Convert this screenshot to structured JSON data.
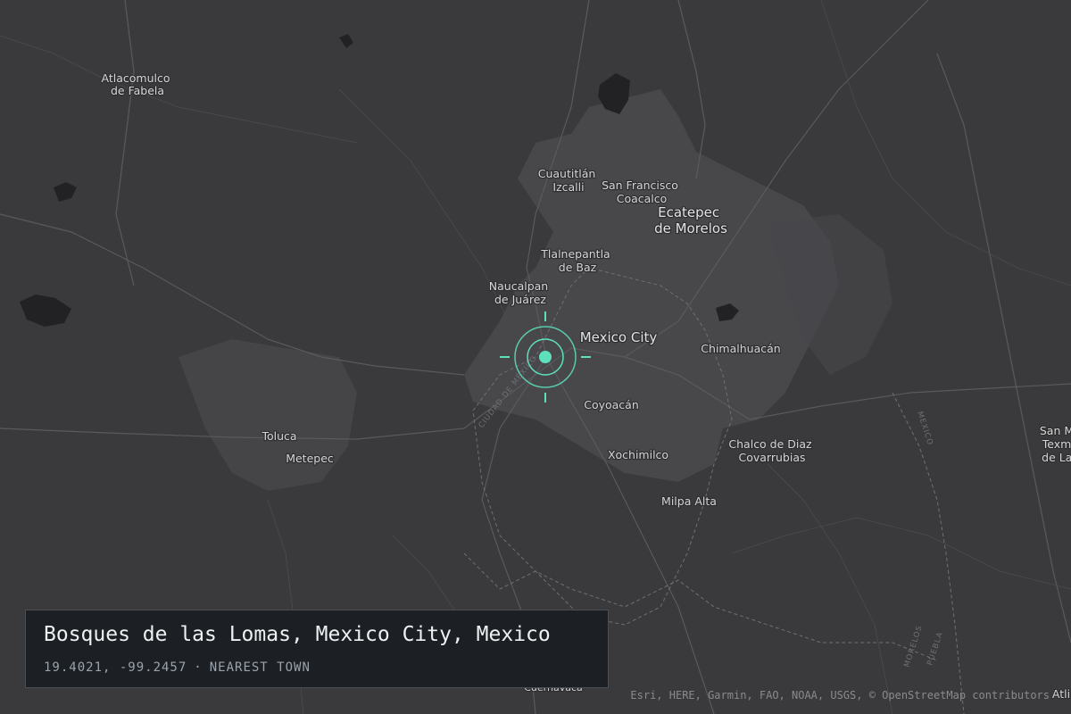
{
  "map": {
    "places": [
      {
        "id": "atlacomulco",
        "lines": [
          "Atlacomulco",
          "de Fabela"
        ]
      },
      {
        "id": "cuautitlan",
        "lines": [
          "Cuautitlán",
          "Izcalli"
        ]
      },
      {
        "id": "san-francisco",
        "lines": [
          "San Francisco",
          "Coacalco"
        ]
      },
      {
        "id": "ecatepec",
        "lines": [
          "Ecatepec",
          "de Morelos"
        ]
      },
      {
        "id": "tlalnepantla",
        "lines": [
          "Tlalnepantla",
          "de Baz"
        ]
      },
      {
        "id": "naucalpan",
        "lines": [
          "Naucalpan",
          "de Juárez"
        ]
      },
      {
        "id": "mexico-city",
        "lines": [
          "Mexico City"
        ]
      },
      {
        "id": "chimalhuacan",
        "lines": [
          "Chimalhuacán"
        ]
      },
      {
        "id": "coyoacan",
        "lines": [
          "Coyoacán"
        ]
      },
      {
        "id": "toluca",
        "lines": [
          "Toluca"
        ]
      },
      {
        "id": "metepec",
        "lines": [
          "Metepec"
        ]
      },
      {
        "id": "xochimilco",
        "lines": [
          "Xochimilco"
        ]
      },
      {
        "id": "chalco",
        "lines": [
          "Chalco de Diaz",
          "Covarrubias"
        ]
      },
      {
        "id": "milpa-alta",
        "lines": [
          "Milpa Alta"
        ]
      },
      {
        "id": "san-texm",
        "lines": [
          "San M",
          "Texm",
          "de Lal"
        ]
      },
      {
        "id": "cuernavaca",
        "lines": [
          "Cuernavaca"
        ]
      },
      {
        "id": "atli",
        "lines": [
          "Atli"
        ]
      }
    ],
    "road_labels": {
      "ciudad_de_mexico": "CIUDAD DE MÉXICO",
      "mexico_state": "MEXICO",
      "morelos": "MORELOS",
      "puebla": "PUEBLA"
    },
    "marker": {
      "color": "#5ee0bd"
    }
  },
  "info_panel": {
    "title": "Bosques de las Lomas, Mexico City, Mexico",
    "coordinates": "19.4021, -99.2457",
    "separator": "·",
    "type": "NEAREST TOWN"
  },
  "attribution": "Esri, HERE, Garmin, FAO, NOAA, USGS, © OpenStreetMap contributors"
}
